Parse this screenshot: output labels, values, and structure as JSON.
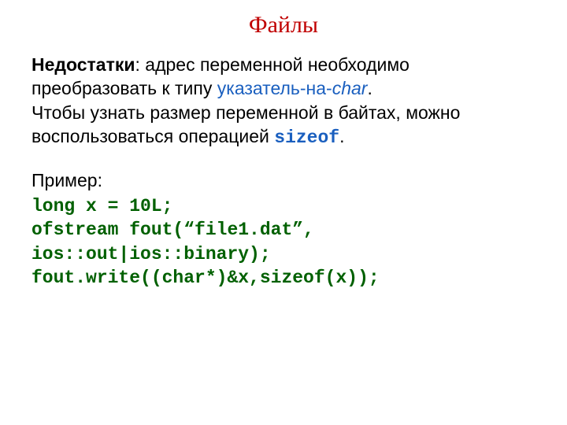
{
  "title": "Файлы",
  "para1": {
    "lead_bold": "Недостатки",
    "after_lead": ": адрес переменной необходимо преобразовать к типу ",
    "link_part": "указатель-на-",
    "link_italic": "char",
    "period": ".",
    "line3": "Чтобы узнать размер переменной в байтах, можно воспользоваться операцией ",
    "sizeof": "sizeof",
    "tail": "."
  },
  "example_label": "Пример:",
  "code": {
    "l1": "long x = 10L;",
    "l2": "ofstream fout(“file1.dat”,",
    "l3": "ios::out|ios::binary);",
    "l4": "fout.write((char*)&x,sizeof(x));"
  }
}
